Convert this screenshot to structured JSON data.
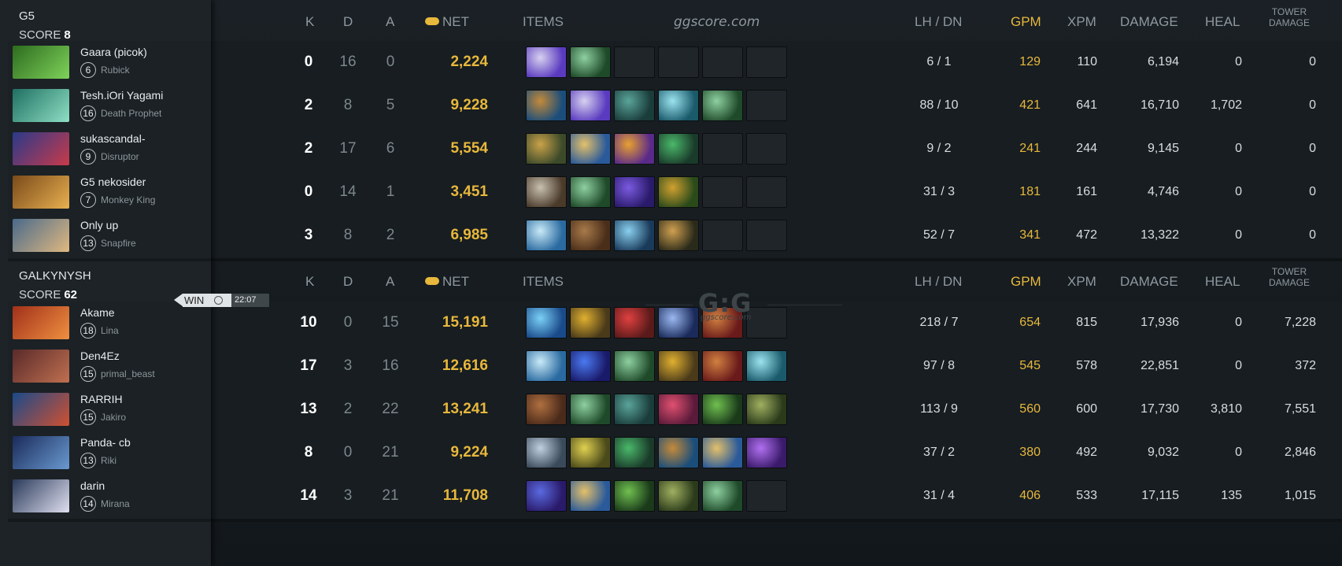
{
  "site": "ggscore.com",
  "watermark_logo": "G:G",
  "watermark_sub": "ggscore.com",
  "columns": {
    "k": "K",
    "d": "D",
    "a": "A",
    "net": "NET",
    "items": "ITEMS",
    "lhdn": "LH  /  DN",
    "gpm": "GPM",
    "xpm": "XPM",
    "damage": "DAMAGE",
    "heal": "HEAL",
    "tower1": "TOWER",
    "tower2": "DAMAGE"
  },
  "win_badge": {
    "label": "WIN",
    "time": "22:07"
  },
  "teams": [
    {
      "name": "G5",
      "score_label": "SCORE",
      "score": "8",
      "players": [
        {
          "name": "Gaara (picok)",
          "level": "6",
          "hero": "Rubick",
          "k": "0",
          "d": "16",
          "a": "0",
          "net": "2,224",
          "lh": "6 / 1",
          "gpm": "129",
          "xpm": "110",
          "damage": "6,194",
          "heal": "0",
          "tower": "0",
          "portrait": [
            "#2d6b1f",
            "#7fd35a"
          ],
          "items": [
            [
              "#5a3bbf",
              "#d7d1f0"
            ],
            [
              "#1f4a2a",
              "#8ed0a0"
            ],
            null,
            null,
            null,
            null
          ]
        },
        {
          "name": "Tesh.iOri Yagami",
          "level": "16",
          "hero": "Death Prophet",
          "k": "2",
          "d": "8",
          "a": "5",
          "net": "9,228",
          "lh": "88 / 10",
          "gpm": "421",
          "xpm": "641",
          "damage": "16,710",
          "heal": "1,702",
          "tower": "0",
          "portrait": [
            "#1f6f62",
            "#8fe0c4"
          ],
          "items": [
            [
              "#1b4d7a",
              "#c48a3a"
            ],
            [
              "#5a3bbf",
              "#d7d1f0"
            ],
            [
              "#1a3c3a",
              "#5aa49a"
            ],
            [
              "#1a5a6a",
              "#9be3ef"
            ],
            [
              "#1f4a2a",
              "#8ed0a0"
            ],
            null
          ]
        },
        {
          "name": "sukascandal-",
          "level": "9",
          "hero": "Disruptor",
          "k": "2",
          "d": "17",
          "a": "6",
          "net": "5,554",
          "lh": "9 / 2",
          "gpm": "241",
          "xpm": "244",
          "damage": "9,145",
          "heal": "0",
          "tower": "0",
          "portrait": [
            "#2a3a8a",
            "#c83a4a"
          ],
          "items": [
            [
              "#3c4a2a",
              "#c9a24a"
            ],
            [
              "#2a5a9a",
              "#e4c06a"
            ],
            [
              "#5a2a8a",
              "#e8a030"
            ],
            [
              "#1a3a2a",
              "#4ab86a"
            ],
            null,
            null
          ]
        },
        {
          "name": "G5 nekosider",
          "level": "7",
          "hero": "Monkey King",
          "k": "0",
          "d": "14",
          "a": "1",
          "net": "3,451",
          "lh": "31 / 3",
          "gpm": "181",
          "xpm": "161",
          "damage": "4,746",
          "heal": "0",
          "tower": "0",
          "portrait": [
            "#7a4a1a",
            "#e8b050"
          ],
          "items": [
            [
              "#4a3a2a",
              "#c8c0b0"
            ],
            [
              "#1f4a2a",
              "#8ed0a0"
            ],
            [
              "#2a1a6a",
              "#7a5ae0"
            ],
            [
              "#2a4a1a",
              "#d0a030"
            ],
            null,
            null
          ]
        },
        {
          "name": "Only up",
          "level": "13",
          "hero": "Snapfire",
          "k": "3",
          "d": "8",
          "a": "2",
          "net": "6,985",
          "lh": "52 / 7",
          "gpm": "341",
          "xpm": "472",
          "damage": "13,322",
          "heal": "0",
          "tower": "0",
          "portrait": [
            "#4a6a8a",
            "#e0b880"
          ],
          "items": [
            [
              "#2a6aa0",
              "#c9eaf7"
            ],
            [
              "#4a2e1a",
              "#a87a4a"
            ],
            [
              "#1a3a5a",
              "#8ad0ef"
            ],
            [
              "#2a2a1a",
              "#d0a050"
            ],
            null,
            null
          ]
        }
      ]
    },
    {
      "name": "GALKYNYSH",
      "score_label": "SCORE",
      "score": "62",
      "players": [
        {
          "name": "Akame",
          "level": "18",
          "hero": "Lina",
          "k": "10",
          "d": "0",
          "a": "15",
          "net": "15,191",
          "lh": "218 / 7",
          "gpm": "654",
          "xpm": "815",
          "damage": "17,936",
          "heal": "0",
          "tower": "7,228",
          "portrait": [
            "#a0301a",
            "#f09040"
          ],
          "items": [
            [
              "#1a4a8a",
              "#7ad0f7"
            ],
            [
              "#4a3a1a",
              "#e0b030"
            ],
            [
              "#5a1a1a",
              "#e04040"
            ],
            [
              "#1a2a5a",
              "#9ab8f0"
            ],
            [
              "#6a1a1a",
              "#d08040"
            ],
            null
          ]
        },
        {
          "name": "Den4Ez",
          "level": "15",
          "hero": "primal_beast",
          "k": "17",
          "d": "3",
          "a": "16",
          "net": "12,616",
          "lh": "97 / 8",
          "gpm": "545",
          "xpm": "578",
          "damage": "22,851",
          "heal": "0",
          "tower": "372",
          "portrait": [
            "#5a2a2a",
            "#c07050"
          ],
          "items": [
            [
              "#2a6aa0",
              "#c9eaf7"
            ],
            [
              "#1a1a6a",
              "#4a7af0"
            ],
            [
              "#1f4a2a",
              "#8ed0a0"
            ],
            [
              "#4a3a1a",
              "#e0b030"
            ],
            [
              "#6a1a1a",
              "#d08040"
            ],
            [
              "#1a5a6a",
              "#9be3ef"
            ]
          ]
        },
        {
          "name": "RARRIH",
          "level": "15",
          "hero": "Jakiro",
          "k": "13",
          "d": "2",
          "a": "22",
          "net": "13,241",
          "lh": "113 / 9",
          "gpm": "560",
          "xpm": "600",
          "damage": "17,730",
          "heal": "3,810",
          "tower": "7,551",
          "portrait": [
            "#1a4a8a",
            "#d05030"
          ],
          "items": [
            [
              "#4a2a1a",
              "#b07040"
            ],
            [
              "#1f4a2a",
              "#8ed0a0"
            ],
            [
              "#1a3c3a",
              "#5aa49a"
            ],
            [
              "#5a1a3a",
              "#e05070"
            ],
            [
              "#1a3a1a",
              "#70c050"
            ],
            [
              "#2a3a1a",
              "#a0b060"
            ]
          ]
        },
        {
          "name": "Panda- cb",
          "level": "13",
          "hero": "Riki",
          "k": "8",
          "d": "0",
          "a": "21",
          "net": "9,224",
          "lh": "37 / 2",
          "gpm": "380",
          "xpm": "492",
          "damage": "9,032",
          "heal": "0",
          "tower": "2,846",
          "portrait": [
            "#1a2a5a",
            "#6a9ad0"
          ],
          "items": [
            [
              "#3a4a5a",
              "#c0d0e0"
            ],
            [
              "#4a4a1a",
              "#e0d050"
            ],
            [
              "#1a3a2a",
              "#4ab86a"
            ],
            [
              "#1b4d7a",
              "#c48a3a"
            ],
            [
              "#2a5a9a",
              "#e4c06a"
            ],
            [
              "#3a1a6a",
              "#b070f0"
            ]
          ]
        },
        {
          "name": "darin",
          "level": "14",
          "hero": "Mirana",
          "k": "14",
          "d": "3",
          "a": "21",
          "net": "11,708",
          "lh": "31 / 4",
          "gpm": "406",
          "xpm": "533",
          "damage": "17,115",
          "heal": "135",
          "tower": "1,015",
          "portrait": [
            "#2a3a5a",
            "#e0e0f0"
          ],
          "items": [
            [
              "#2a1a6a",
              "#5a6ae0"
            ],
            [
              "#2a5a9a",
              "#e4c06a"
            ],
            [
              "#1a3a1a",
              "#70c050"
            ],
            [
              "#2a3a1a",
              "#a0b060"
            ],
            [
              "#1f4a2a",
              "#8ed0a0"
            ],
            null
          ]
        }
      ]
    }
  ]
}
